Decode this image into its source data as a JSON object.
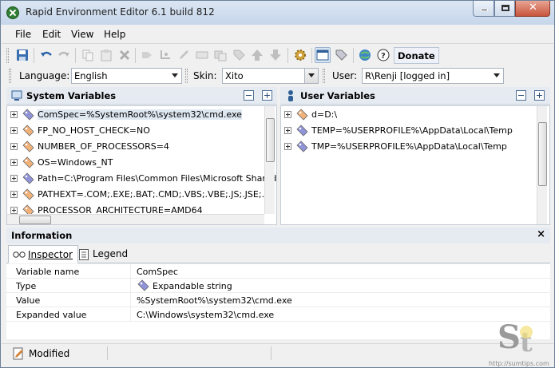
{
  "window": {
    "title": "Rapid Environment Editor 6.1 build 812"
  },
  "menu": [
    "File",
    "Edit",
    "View",
    "Help"
  ],
  "toolbar": {
    "donate_label": "Donate",
    "icons": [
      "save-icon",
      "undo-icon",
      "redo-icon",
      "copy-icon",
      "paste-icon",
      "delete-icon",
      "insert-variable-icon",
      "insert-value-icon",
      "edit-icon",
      "rename-icon",
      "clone-icon",
      "tag-icon",
      "move-up-icon",
      "move-down-icon",
      "settings-icon",
      "window-icon",
      "legend-icon",
      "web-icon",
      "help-icon"
    ]
  },
  "settings": {
    "language_label": "Language:",
    "language_value": "English",
    "skin_label": "Skin:",
    "skin_value": "Xito",
    "user_label": "User:",
    "user_value": "R\\Renji [logged in]"
  },
  "system_panel": {
    "title": "System Variables",
    "rows": [
      {
        "text": "ComSpec=%SystemRoot%\\system32\\cmd.exe",
        "kind": "expandable"
      },
      {
        "text": "FP_NO_HOST_CHECK=NO",
        "kind": "string"
      },
      {
        "text": "NUMBER_OF_PROCESSORS=4",
        "kind": "string"
      },
      {
        "text": "OS=Windows_NT",
        "kind": "string"
      },
      {
        "text": "Path=C:\\Program Files\\Common Files\\Microsoft Shared\\W",
        "kind": "expandable"
      },
      {
        "text": "PATHEXT=.COM;.EXE;.BAT;.CMD;.VBS;.VBE;.JS;.JSE;.W",
        "kind": "string"
      },
      {
        "text": "PROCESSOR_ARCHITECTURE=AMD64",
        "kind": "string"
      }
    ]
  },
  "user_panel": {
    "title": "User Variables",
    "rows": [
      {
        "text": "d=D:\\",
        "kind": "string"
      },
      {
        "text": "TEMP=%USERPROFILE%\\AppData\\Local\\Temp",
        "kind": "expandable"
      },
      {
        "text": "TMP=%USERPROFILE%\\AppData\\Local\\Temp",
        "kind": "expandable"
      }
    ]
  },
  "info": {
    "title": "Information",
    "close": "×",
    "tabs": [
      "Inspector",
      "Legend"
    ],
    "props": [
      {
        "name": "Variable name",
        "value": "ComSpec"
      },
      {
        "name": "Type",
        "value": "Expandable string"
      },
      {
        "name": "Value",
        "value": "%SystemRoot%\\system32\\cmd.exe"
      },
      {
        "name": "Expanded value",
        "value": "C:\\Windows\\system32\\cmd.exe"
      }
    ]
  },
  "status": {
    "text": "Modified"
  },
  "watermark": {
    "url": "http://sumtips.com"
  },
  "colors": {
    "string_tag": "#f1b27a",
    "expandable_tag": "#8f93d8",
    "accent": "#2f5f96"
  }
}
